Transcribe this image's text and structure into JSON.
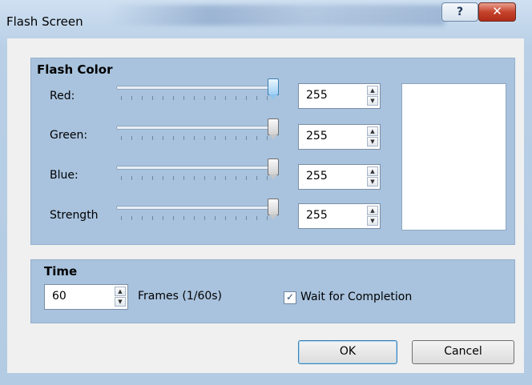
{
  "window": {
    "title": "Flash Screen",
    "help_label": "?",
    "close_label": "✕"
  },
  "flash_color": {
    "heading": "Flash Color",
    "channels": [
      {
        "label": "Red:",
        "value": "255",
        "level": 255
      },
      {
        "label": "Green:",
        "value": "255",
        "level": 255
      },
      {
        "label": "Blue:",
        "value": "255",
        "level": 255
      },
      {
        "label": "Strength",
        "value": "255",
        "level": 255
      }
    ],
    "preview_color": "#ffffff"
  },
  "time": {
    "heading": "Time",
    "frames_value": "60",
    "frames_label": "Frames (1/60s)",
    "wait_label": "Wait for Completion",
    "wait_checked": true
  },
  "buttons": {
    "ok": "OK",
    "cancel": "Cancel"
  },
  "colors": {
    "group_bg": "#a9c3de",
    "dialog_bg": "#f0f0f0",
    "accent": "#3c7fb1"
  }
}
